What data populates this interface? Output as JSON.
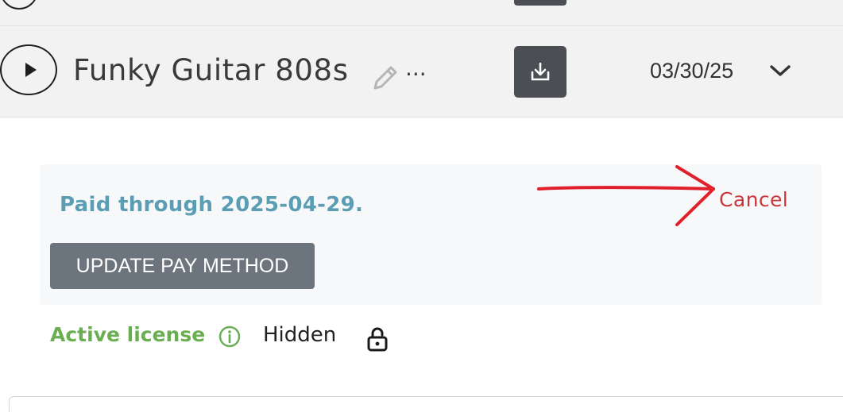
{
  "track": {
    "title": "Funky Guitar 808s",
    "ellipsis": "...",
    "date": "03/30/25"
  },
  "subscription": {
    "paid_text": "Paid through 2025-04-29.",
    "cancel_label": "Cancel",
    "update_button_label": "UPDATE PAY METHOD"
  },
  "license": {
    "status": "Active license",
    "visibility": "Hidden"
  },
  "icons": {
    "play": "play-icon",
    "edit": "pencil-icon",
    "download": "download-icon",
    "expand": "chevron-down-icon",
    "info": "info-icon",
    "lock": "lock-icon",
    "annotation": "red-arrow"
  },
  "colors": {
    "row_background": "#f2f2f2",
    "download_button": "#4b4f54",
    "paid_text": "#5b9db3",
    "cancel": "#c9373b",
    "update_button": "#6c757d",
    "active_license": "#6aae52",
    "annotation_arrow": "#e0202a"
  }
}
